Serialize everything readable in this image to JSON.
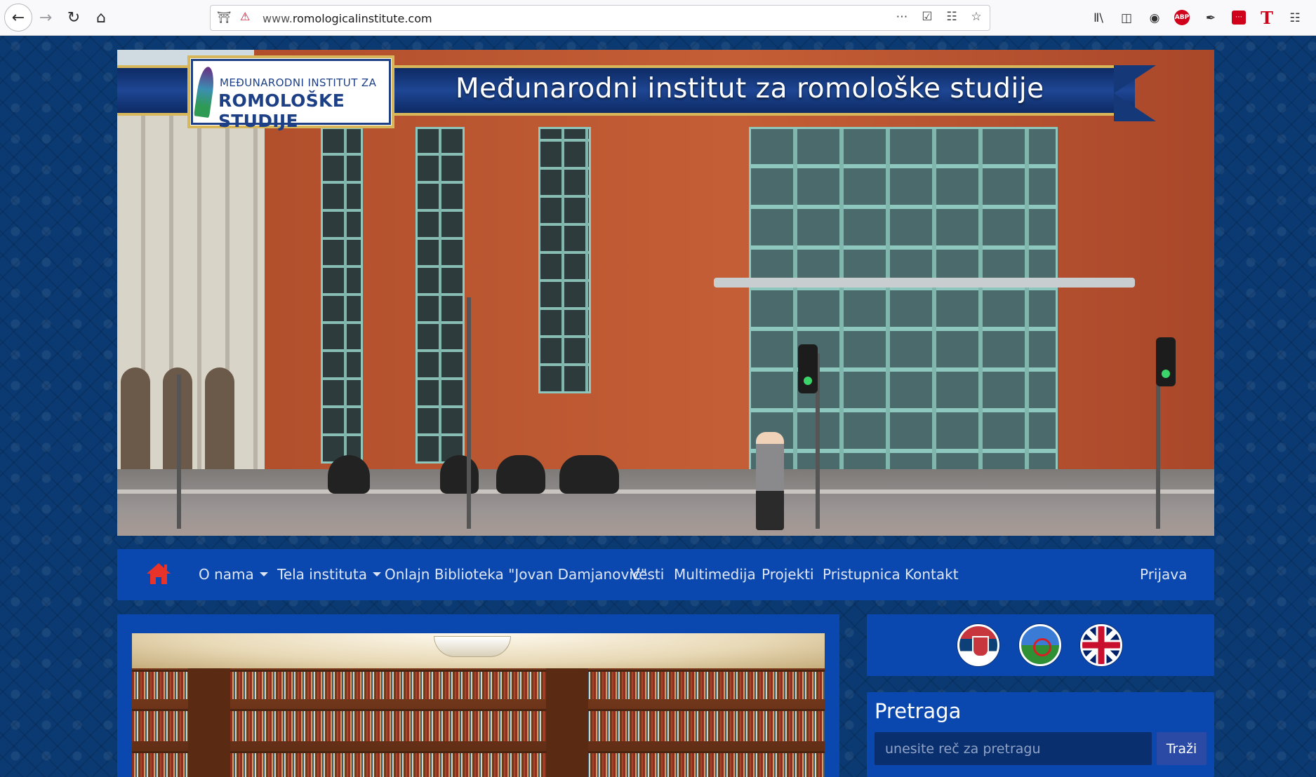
{
  "browser": {
    "url_prefix": "www.",
    "url_domain": "romologicalinstitute.com",
    "icons": {
      "back": "back-arrow-icon",
      "forward": "forward-arrow-icon",
      "reload": "reload-icon",
      "home": "home-icon",
      "menu": "ellipsis-icon",
      "pocket": "pocket-icon",
      "translate": "translate-icon",
      "bookmark": "star-icon"
    },
    "extensions": {
      "library": "Ⅱ\\",
      "abp_label": "ABP",
      "t_label": "T"
    }
  },
  "header": {
    "banner_title": "Međunarodni institut za romološke studije",
    "logo_line1": "MEĐUNARODNI INSTITUT ZA",
    "logo_line2": "ROMOLOŠKE STUDIJE"
  },
  "nav": {
    "items": [
      {
        "label": "O nama",
        "dropdown": true
      },
      {
        "label": "Tela instituta",
        "dropdown": true
      },
      {
        "label": "Onlajn Biblioteka \"Jovan Damjanović\"",
        "dropdown": false
      },
      {
        "label": "Vesti",
        "dropdown": false
      },
      {
        "label": "Multimedija",
        "dropdown": false
      },
      {
        "label": "Projekti",
        "dropdown": false
      },
      {
        "label": "Pristupnica",
        "dropdown": false
      },
      {
        "label": "Kontakt",
        "dropdown": false
      }
    ],
    "login": "Prijava",
    "home_color": "#e8332a"
  },
  "sidebar": {
    "languages": [
      "serbian-flag-icon",
      "romani-flag-icon",
      "uk-flag-icon"
    ],
    "search": {
      "title": "Pretraga",
      "placeholder": "unesite reč za pretragu",
      "button": "Traži"
    }
  },
  "colors": {
    "page_bg": "#0b3a73",
    "panel": "#0a48b0",
    "nav_text": "#dfe7f6",
    "search_button": "#2a4aa5"
  }
}
